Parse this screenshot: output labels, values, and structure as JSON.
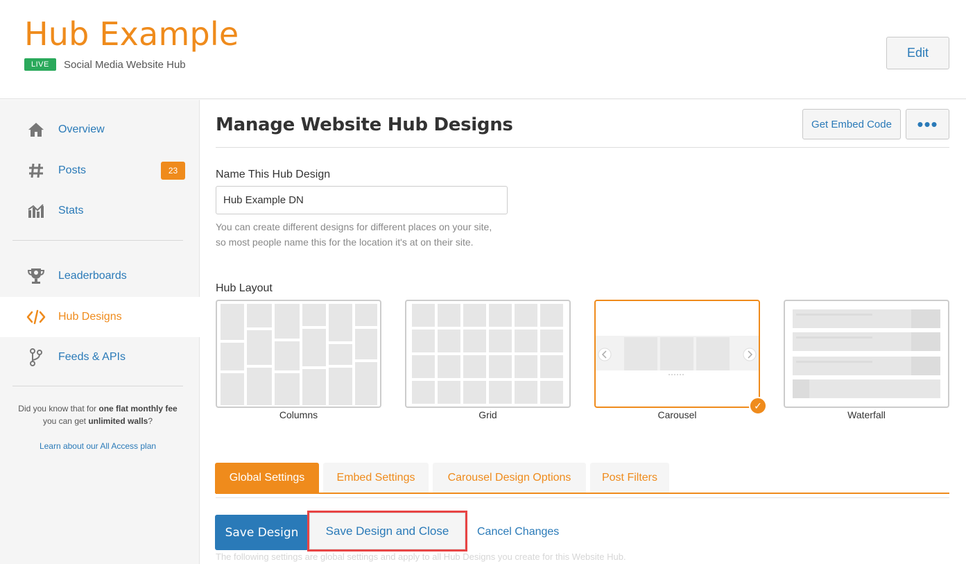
{
  "header": {
    "title": "Hub Example",
    "status_badge": "LIVE",
    "subtitle": "Social Media Website Hub",
    "edit_label": "Edit"
  },
  "sidebar": {
    "items": [
      {
        "label": "Overview",
        "icon": "home-icon"
      },
      {
        "label": "Posts",
        "icon": "hashtag-icon",
        "count": "23"
      },
      {
        "label": "Stats",
        "icon": "chart-icon"
      },
      {
        "label": "Leaderboards",
        "icon": "trophy-icon"
      },
      {
        "label": "Hub Designs",
        "icon": "code-icon",
        "active": true
      },
      {
        "label": "Feeds & APIs",
        "icon": "fork-icon"
      }
    ],
    "promo": {
      "p1": "Did you know that for ",
      "b1": "one flat monthly fee",
      "p2": " you can get ",
      "b2": "unlimited walls",
      "p3": "?",
      "link": "Learn about our All Access plan"
    }
  },
  "main": {
    "title": "Manage Website Hub Designs",
    "embed_label": "Get Embed Code",
    "more_label": "•••",
    "name_label": "Name This Hub Design",
    "name_value": "Hub Example DN",
    "help_line1": "You can create different designs for different places on your site,",
    "help_line2": "so most people name this for the location it's at on their site.",
    "layout_label": "Hub Layout",
    "layouts": [
      "Columns",
      "Grid",
      "Carousel",
      "Waterfall"
    ],
    "selected_layout": "Carousel",
    "tabs": [
      "Global Settings",
      "Embed Settings",
      "Carousel Design Options",
      "Post Filters"
    ],
    "active_tab": "Global Settings",
    "save_label": "Save Design",
    "save_close_label": "Save Design and Close",
    "cancel_label": "Cancel Changes",
    "footer_note": "The following settings are global settings and apply to all Hub Designs you create for this Website Hub."
  },
  "colors": {
    "brand_orange": "#ef8b1c",
    "link_blue": "#2a7ab8",
    "live_green": "#2aa95b",
    "highlight_red": "#e84545"
  }
}
